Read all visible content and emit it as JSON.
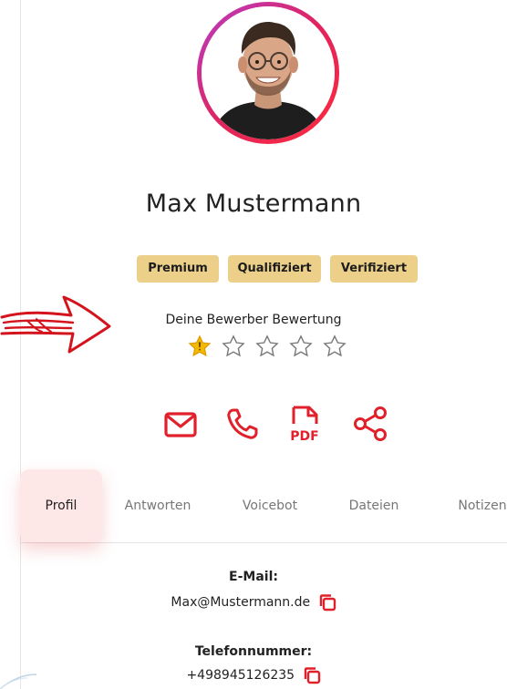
{
  "profile": {
    "name": "Max Mustermann",
    "badges": [
      "Premium",
      "Qualifiziert",
      "Verifiziert"
    ]
  },
  "rating": {
    "label": "Deine Bewerber Bewertung",
    "value": 1,
    "max": 5
  },
  "actions": [
    {
      "icon": "mail-icon"
    },
    {
      "icon": "phone-icon"
    },
    {
      "icon": "pdf-icon"
    },
    {
      "icon": "share-icon"
    }
  ],
  "tabs": [
    {
      "label": "Profil",
      "active": true
    },
    {
      "label": "Antworten"
    },
    {
      "label": "Voicebot"
    },
    {
      "label": "Dateien"
    },
    {
      "label": "Notizen"
    }
  ],
  "contact": {
    "email_label": "E-Mail:",
    "email_value": "Max@Mustermann.de",
    "phone_label": "Telefonnummer:",
    "phone_value": "+498945126235"
  },
  "colors": {
    "accent": "#e0202a",
    "badge": "#ecd08a",
    "star_active": "#f5b800",
    "arrow": "#d4141c"
  }
}
